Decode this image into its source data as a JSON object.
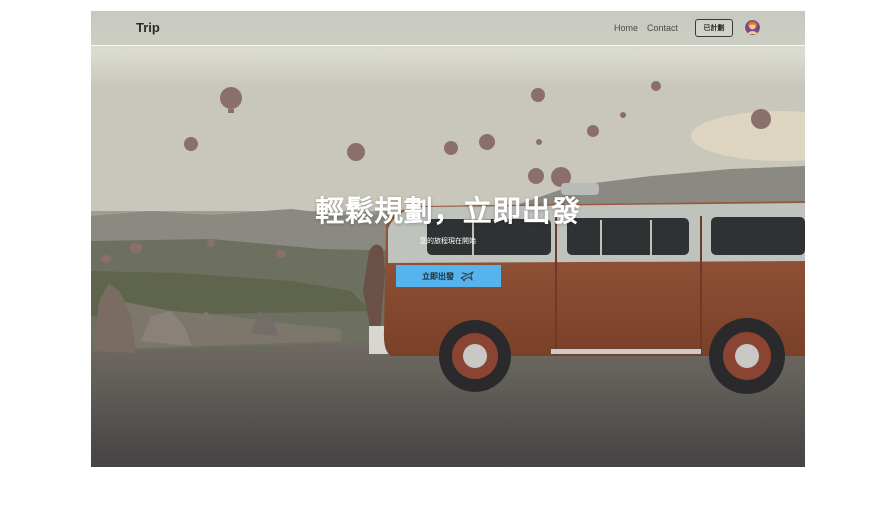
{
  "navbar": {
    "brand": "Trip",
    "links": [
      "Home",
      "Contact"
    ],
    "plans_label": "已計劃",
    "avatar_icon": "user-avatar-icon"
  },
  "hero": {
    "title": "輕鬆規劃，立即出發",
    "subtitle": "您的旅程現在開始",
    "cta_label": "立即出發",
    "cta_icon": "airplane-icon",
    "cta_color": "#55b4ee"
  },
  "background": {
    "image": "cappadocia-hot-air-balloons-with-orange-van"
  }
}
